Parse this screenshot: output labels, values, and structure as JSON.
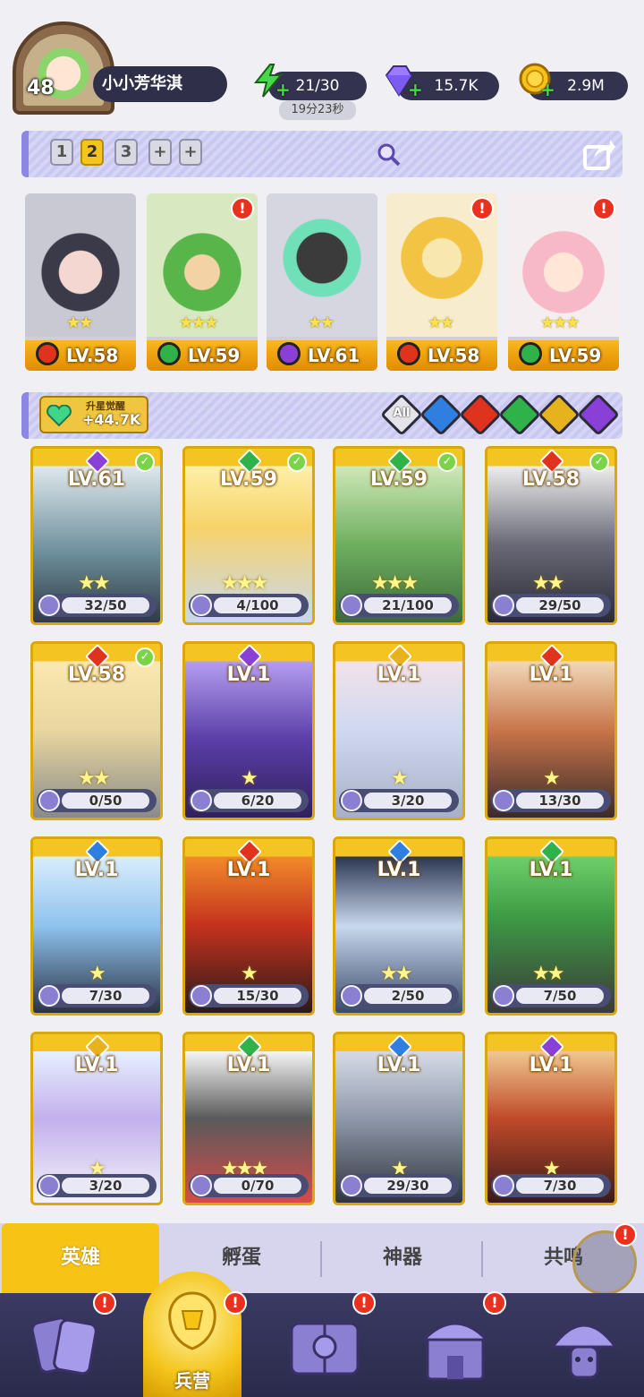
{
  "player": {
    "level": "48",
    "name": "小小芳华淇"
  },
  "resources": {
    "energy": "21/30",
    "energy_timer": "19分23秒",
    "gems": "15.7K",
    "gold": "2.9M"
  },
  "team_slots": [
    "1",
    "2",
    "3"
  ],
  "team_slot_active": "2",
  "team_heroes": [
    {
      "level": "LV.58",
      "element": "fire",
      "stars": "★★",
      "alert": false
    },
    {
      "level": "LV.59",
      "element": "nature",
      "stars": "★★★",
      "alert": true
    },
    {
      "level": "LV.61",
      "element": "dark",
      "stars": "★★",
      "alert": false
    },
    {
      "level": "LV.58",
      "element": "fire",
      "stars": "★★",
      "alert": true
    },
    {
      "level": "LV.59",
      "element": "nature",
      "stars": "★★★",
      "alert": true
    }
  ],
  "awaken": {
    "label": "升星觉醒",
    "value": "+44.7K"
  },
  "filters": {
    "all_label": "All",
    "elements": [
      "water",
      "fire",
      "nature",
      "light",
      "dark"
    ]
  },
  "heroes": [
    {
      "level": "LV.61",
      "element": "dark",
      "progress": "32/50",
      "stars": "★★",
      "checked": true
    },
    {
      "level": "LV.59",
      "element": "nature",
      "progress": "4/100",
      "stars": "★★★",
      "checked": true
    },
    {
      "level": "LV.59",
      "element": "nature",
      "progress": "21/100",
      "stars": "★★★",
      "checked": true
    },
    {
      "level": "LV.58",
      "element": "fire",
      "progress": "29/50",
      "stars": "★★",
      "checked": true
    },
    {
      "level": "LV.58",
      "element": "fire",
      "progress": "0/50",
      "stars": "★★",
      "checked": true
    },
    {
      "level": "LV.1",
      "element": "dark",
      "progress": "6/20",
      "stars": "★",
      "checked": false
    },
    {
      "level": "LV.1",
      "element": "light",
      "progress": "3/20",
      "stars": "★",
      "checked": false
    },
    {
      "level": "LV.1",
      "element": "fire",
      "progress": "13/30",
      "stars": "★",
      "checked": false
    },
    {
      "level": "LV.1",
      "element": "water",
      "progress": "7/30",
      "stars": "★",
      "checked": false
    },
    {
      "level": "LV.1",
      "element": "fire",
      "progress": "15/30",
      "stars": "★",
      "checked": false
    },
    {
      "level": "LV.1",
      "element": "water",
      "progress": "2/50",
      "stars": "★★",
      "checked": false
    },
    {
      "level": "LV.1",
      "element": "nature",
      "progress": "7/50",
      "stars": "★★",
      "checked": false
    },
    {
      "level": "LV.1",
      "element": "light",
      "progress": "3/20",
      "stars": "★",
      "checked": false
    },
    {
      "level": "LV.1",
      "element": "nature",
      "progress": "0/70",
      "stars": "★★★",
      "checked": false
    },
    {
      "level": "LV.1",
      "element": "water",
      "progress": "29/30",
      "stars": "★",
      "checked": false
    },
    {
      "level": "LV.1",
      "element": "dark",
      "progress": "7/30",
      "stars": "★",
      "checked": false
    }
  ],
  "tabs": [
    "英雄",
    "孵蛋",
    "神器",
    "共鸣"
  ],
  "tab_active": "英雄",
  "nav": {
    "active_label": "兵营"
  },
  "alert_mark": "!",
  "colors": {
    "fire": "#e0331e",
    "nature": "#2fb24a",
    "dark": "#8a3fd6",
    "water": "#2f7fe0",
    "light": "#e6b21e",
    "accent": "#f7c416",
    "panel": "#d6d5f6"
  }
}
